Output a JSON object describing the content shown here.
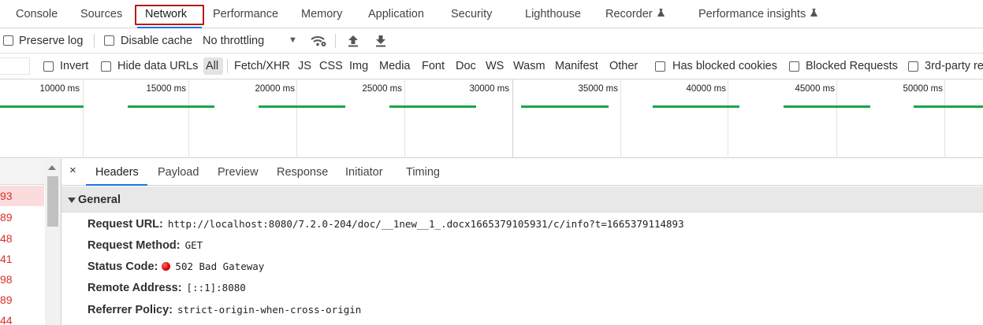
{
  "tabs": [
    {
      "label": "Console"
    },
    {
      "label": "Sources"
    },
    {
      "label": "Network"
    },
    {
      "label": "Performance"
    },
    {
      "label": "Memory"
    },
    {
      "label": "Application"
    },
    {
      "label": "Security"
    },
    {
      "label": "Lighthouse"
    },
    {
      "label": "Recorder"
    },
    {
      "label": "Performance insights"
    }
  ],
  "active_tab": "Network",
  "toolbar": {
    "preserve_log": "Preserve log",
    "disable_cache": "Disable cache",
    "throttling": "No throttling",
    "throttling_arrow": "▼"
  },
  "filter": {
    "invert": "Invert",
    "hide_data_urls": "Hide data URLs",
    "types": [
      "All",
      "Fetch/XHR",
      "JS",
      "CSS",
      "Img",
      "Media",
      "Font",
      "Doc",
      "WS",
      "Wasm",
      "Manifest",
      "Other"
    ],
    "selected_type": "All",
    "has_blocked_cookies": "Has blocked cookies",
    "blocked_requests": "Blocked Requests",
    "third_party": "3rd-party re"
  },
  "timeline": {
    "ticks": [
      "10000 ms",
      "15000 ms",
      "20000 ms",
      "25000 ms",
      "30000 ms",
      "35000 ms",
      "40000 ms",
      "45000 ms",
      "50000 ms"
    ],
    "bar_color": "#19a54a"
  },
  "requests": [
    "93",
    "89",
    "48",
    "41",
    "98",
    "89",
    "44"
  ],
  "selected_request_index": 0,
  "detail": {
    "close": "×",
    "tabs": [
      "Headers",
      "Payload",
      "Preview",
      "Response",
      "Initiator",
      "Timing"
    ],
    "active_tab": "Headers",
    "section_title": "General",
    "fields": [
      {
        "key": "Request URL:",
        "value": "http://localhost:8080/7.2.0-204/doc/__1new__1_.docx1665379105931/c/info?t=1665379114893"
      },
      {
        "key": "Request Method:",
        "value": "GET"
      },
      {
        "key": "Status Code:",
        "value": "502 Bad Gateway"
      },
      {
        "key": "Remote Address:",
        "value": "[::1]:8080"
      },
      {
        "key": "Referrer Policy:",
        "value": "strict-origin-when-cross-origin"
      }
    ]
  },
  "colors": {
    "accent": "#1a73e8",
    "highlight_border": "#b31c1c",
    "error_text": "#d93025",
    "selected_row": "#fbdcdc"
  }
}
